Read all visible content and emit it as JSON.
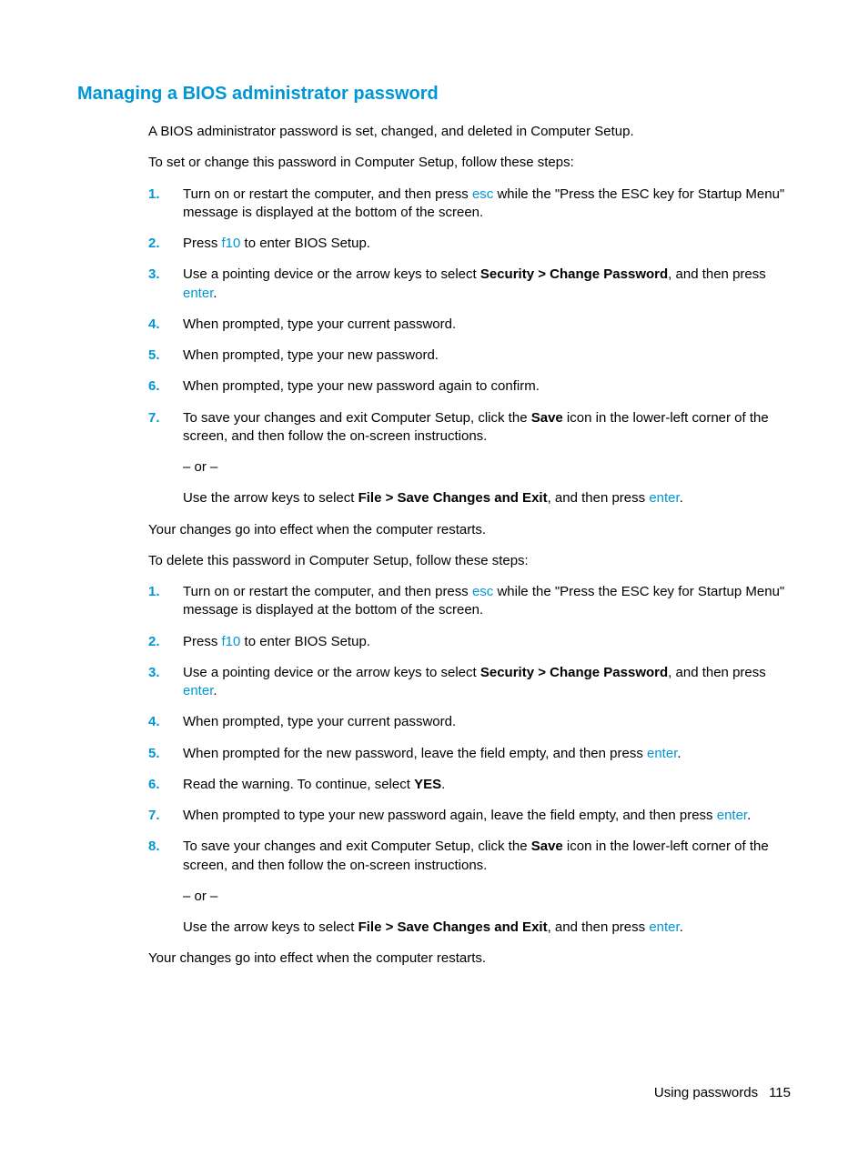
{
  "heading": "Managing a BIOS administrator password",
  "intro": "A BIOS administrator password is set, changed, and deleted in Computer Setup.",
  "setInstr": "To set or change this password in Computer Setup, follow these steps:",
  "list1": {
    "n1": "1.",
    "s1a": "Turn on or restart the computer, and then press ",
    "s1key": "esc",
    "s1b": " while the \"Press the ESC key for Startup Menu\" message is displayed at the bottom of the screen.",
    "n2": "2.",
    "s2a": "Press ",
    "s2key": "f10",
    "s2b": " to enter BIOS Setup.",
    "n3": "3.",
    "s3a": "Use a pointing device or the arrow keys to select ",
    "s3bold": "Security > Change Password",
    "s3b": ", and then press ",
    "s3key": "enter",
    "s3c": ".",
    "n4": "4.",
    "s4": "When prompted, type your current password.",
    "n5": "5.",
    "s5": "When prompted, type your new password.",
    "n6": "6.",
    "s6": "When prompted, type your new password again to confirm.",
    "n7": "7.",
    "s7a": "To save your changes and exit Computer Setup, click the ",
    "s7bold": "Save",
    "s7b": " icon in the lower-left corner of the screen, and then follow the on-screen instructions.",
    "s7or": "– or –",
    "s7c": "Use the arrow keys to select ",
    "s7bold2": "File > Save Changes and Exit",
    "s7d": ", and then press ",
    "s7key": "enter",
    "s7e": "."
  },
  "effect1": "Your changes go into effect when the computer restarts.",
  "delInstr": "To delete this password in Computer Setup, follow these steps:",
  "list2": {
    "n1": "1.",
    "s1a": "Turn on or restart the computer, and then press ",
    "s1key": "esc",
    "s1b": " while the \"Press the ESC key for Startup Menu\" message is displayed at the bottom of the screen.",
    "n2": "2.",
    "s2a": "Press ",
    "s2key": "f10",
    "s2b": " to enter BIOS Setup.",
    "n3": "3.",
    "s3a": "Use a pointing device or the arrow keys to select ",
    "s3bold": "Security > Change Password",
    "s3b": ", and then press ",
    "s3key": "enter",
    "s3c": ".",
    "n4": "4.",
    "s4": "When prompted, type your current password.",
    "n5": "5.",
    "s5a": "When prompted for the new password, leave the field empty, and then press ",
    "s5key": "enter",
    "s5b": ".",
    "n6": "6.",
    "s6a": "Read the warning. To continue, select ",
    "s6bold": "YES",
    "s6b": ".",
    "n7": "7.",
    "s7a": "When prompted to type your new password again, leave the field empty, and then press ",
    "s7key": "enter",
    "s7b": ".",
    "n8": "8.",
    "s8a": "To save your changes and exit Computer Setup, click the ",
    "s8bold": "Save",
    "s8b": " icon in the lower-left corner of the screen, and then follow the on-screen instructions.",
    "s8or": "– or –",
    "s8c": "Use the arrow keys to select ",
    "s8bold2": "File > Save Changes and Exit",
    "s8d": ", and then press ",
    "s8key": "enter",
    "s8e": "."
  },
  "effect2": "Your changes go into effect when the computer restarts.",
  "footer": {
    "section": "Using passwords",
    "page": "115"
  }
}
